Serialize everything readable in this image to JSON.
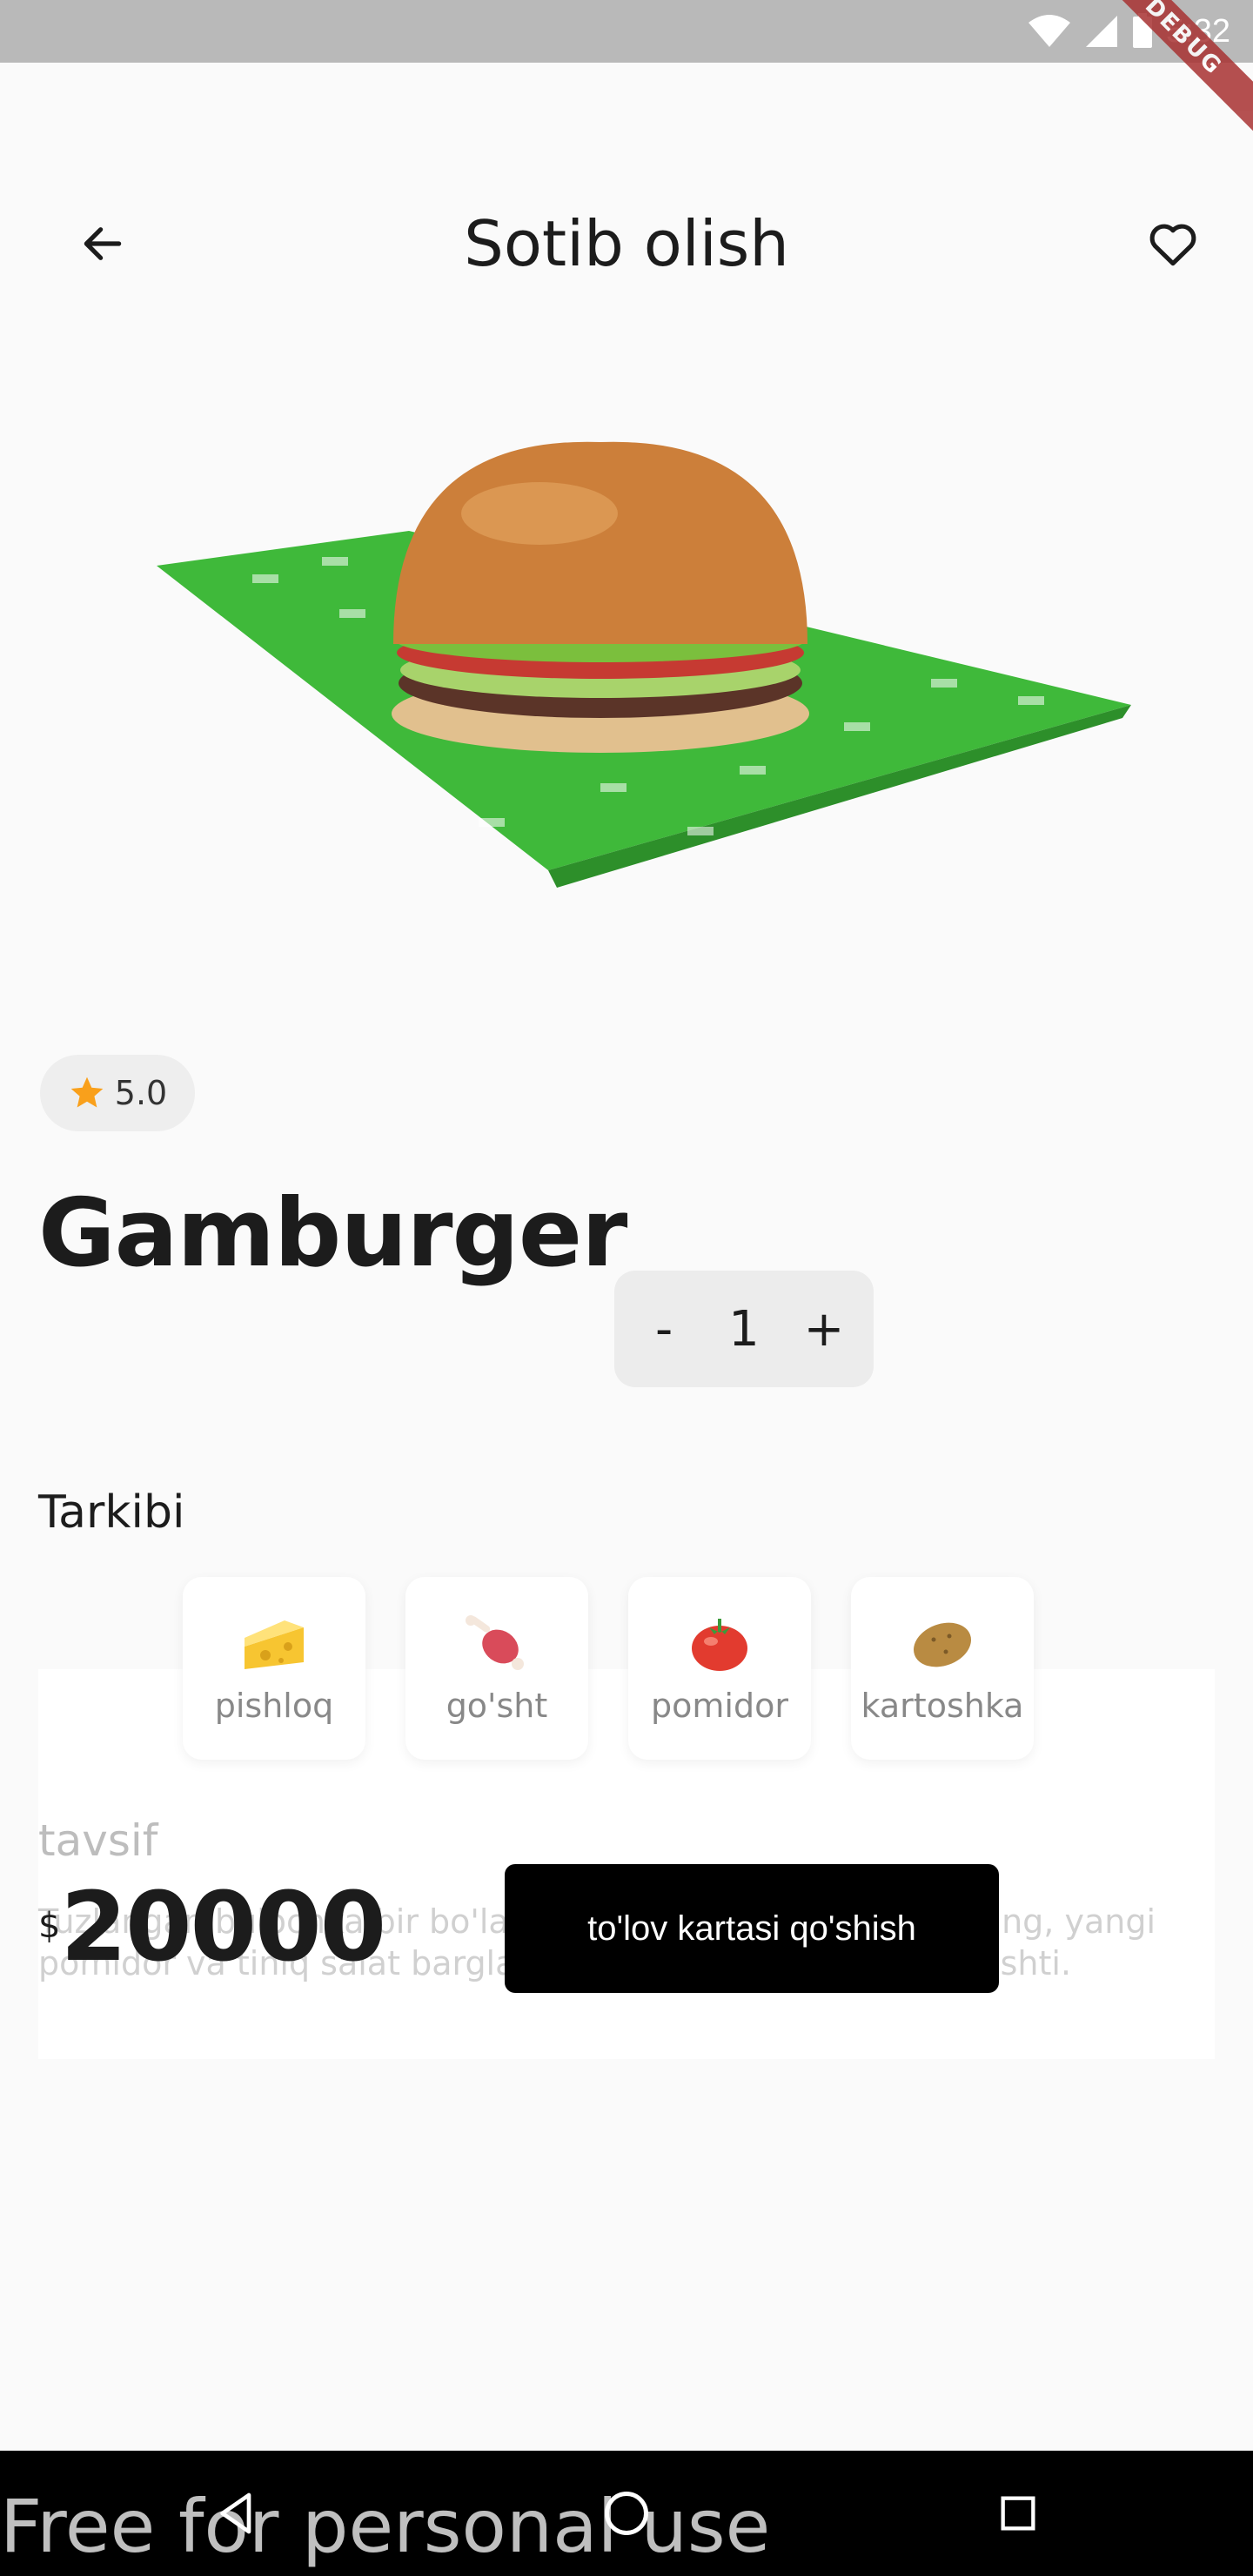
{
  "status_bar": {
    "time": "5:32",
    "debug_label": "DEBUG"
  },
  "header": {
    "title": "Sotib olish"
  },
  "product": {
    "rating": "5.0",
    "name": "Gamburger",
    "quantity": "1",
    "quantity_minus": "-",
    "quantity_plus": "+",
    "price_currency": "$",
    "price": "20000"
  },
  "ingredients_section": {
    "title": "Tarkibi",
    "items": [
      {
        "label": "pishloq",
        "icon": "cheese-icon"
      },
      {
        "label": "go'sht",
        "icon": "meat-icon"
      },
      {
        "label": "pomidor",
        "icon": "tomato-icon"
      },
      {
        "label": "kartoshka",
        "icon": "potato-icon"
      }
    ]
  },
  "description": {
    "title": "tavsif",
    "text": "Tuzlangan bulochka bir bo'lak mol go'shti, tuzlangan bodring, yangi pomidor va tiniq salat barglari maxsus sousli suvli mol go'shti."
  },
  "actions": {
    "pay_button": "to'lov kartasi qo'shish"
  },
  "watermark": "Free for personal use",
  "colors": {
    "star": "#f9a01b",
    "wrapper_green": "#3fb93a",
    "button": "#000000"
  }
}
